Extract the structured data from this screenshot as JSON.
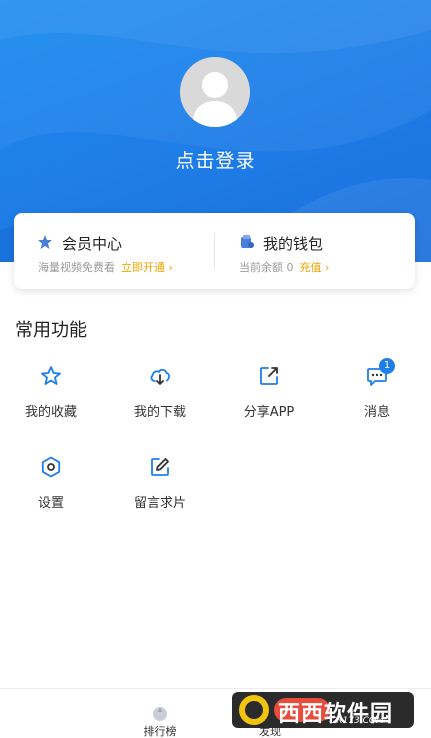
{
  "colors": {
    "accent": "#1f7fe8",
    "link": "#f2a300",
    "badge": "#1f7fe8"
  },
  "profile": {
    "login_text": "点击登录"
  },
  "member_card": {
    "title": "会员中心",
    "subtitle": "海量视频免费看",
    "action": "立即开通 ›",
    "icon": "star-icon"
  },
  "wallet_card": {
    "title": "我的钱包",
    "subtitle": "当前余额 0",
    "action": "充值 ›",
    "icon": "wallet-icon"
  },
  "section": {
    "title": "常用功能"
  },
  "functions": [
    {
      "label": "我的收藏",
      "icon": "star-outline-icon"
    },
    {
      "label": "我的下载",
      "icon": "cloud-download-icon"
    },
    {
      "label": "分享APP",
      "icon": "share-icon"
    },
    {
      "label": "消息",
      "icon": "message-icon",
      "badge": "1"
    },
    {
      "label": "设置",
      "icon": "settings-icon"
    },
    {
      "label": "留言求片",
      "icon": "edit-icon"
    }
  ],
  "bottom_nav": [
    {
      "label": "排行榜",
      "icon": "ranking-icon"
    },
    {
      "label": "发现",
      "icon": "discover-icon"
    }
  ],
  "watermark": {
    "text": "西西软件园",
    "sub": "CR173.COM"
  }
}
